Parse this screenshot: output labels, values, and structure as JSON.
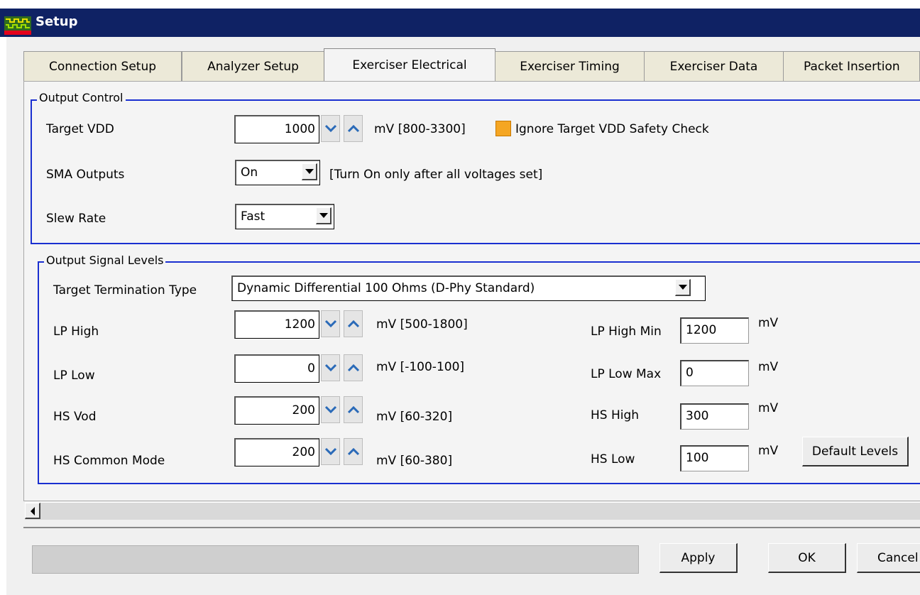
{
  "window": {
    "title": "Setup"
  },
  "tabs": [
    {
      "label": "Connection Setup"
    },
    {
      "label": "Analyzer Setup"
    },
    {
      "label": "Exerciser Electrical"
    },
    {
      "label": "Exerciser Timing"
    },
    {
      "label": "Exerciser Data"
    },
    {
      "label": "Packet Insertion"
    }
  ],
  "active_tab": "Exerciser Electrical",
  "output_control": {
    "legend": "Output Control",
    "target_vdd": {
      "label": "Target VDD",
      "value": "1000",
      "range": "mV [800-3300]"
    },
    "ignore_check": {
      "label": "Ignore Target VDD Safety Check",
      "checked": true
    },
    "sma_outputs": {
      "label": "SMA Outputs",
      "value": "On",
      "note": "[Turn On only after all voltages set]"
    },
    "slew_rate": {
      "label": "Slew Rate",
      "value": "Fast"
    }
  },
  "output_signal_levels": {
    "legend": "Output Signal Levels",
    "termination": {
      "label": "Target Termination Type",
      "value": "Dynamic Differential 100 Ohms (D-Phy Standard)"
    },
    "lp_high": {
      "label": "LP High",
      "value": "1200",
      "range": "mV [500-1800]"
    },
    "lp_low": {
      "label": "LP Low",
      "value": "0",
      "range": "mV [-100-100]"
    },
    "hs_vod": {
      "label": "HS Vod",
      "value": "200",
      "range": "mV [60-320]"
    },
    "hs_common_mode": {
      "label": "HS Common Mode",
      "value": "200",
      "range": "mV [60-380]"
    },
    "lp_high_min": {
      "label": "LP High Min",
      "value": "1200",
      "unit": "mV"
    },
    "lp_low_max": {
      "label": "LP Low Max",
      "value": "0",
      "unit": "mV"
    },
    "hs_high": {
      "label": "HS High",
      "value": "300",
      "unit": "mV"
    },
    "hs_low": {
      "label": "HS Low",
      "value": "100",
      "unit": "mV"
    },
    "default_levels": "Default Levels"
  },
  "buttons": {
    "apply": "Apply",
    "ok": "OK",
    "cancel": "Cancel"
  },
  "colors": {
    "titlebar": "#0f2264",
    "group_border": "#1a2fd0",
    "checkbox": "#f5a623"
  }
}
